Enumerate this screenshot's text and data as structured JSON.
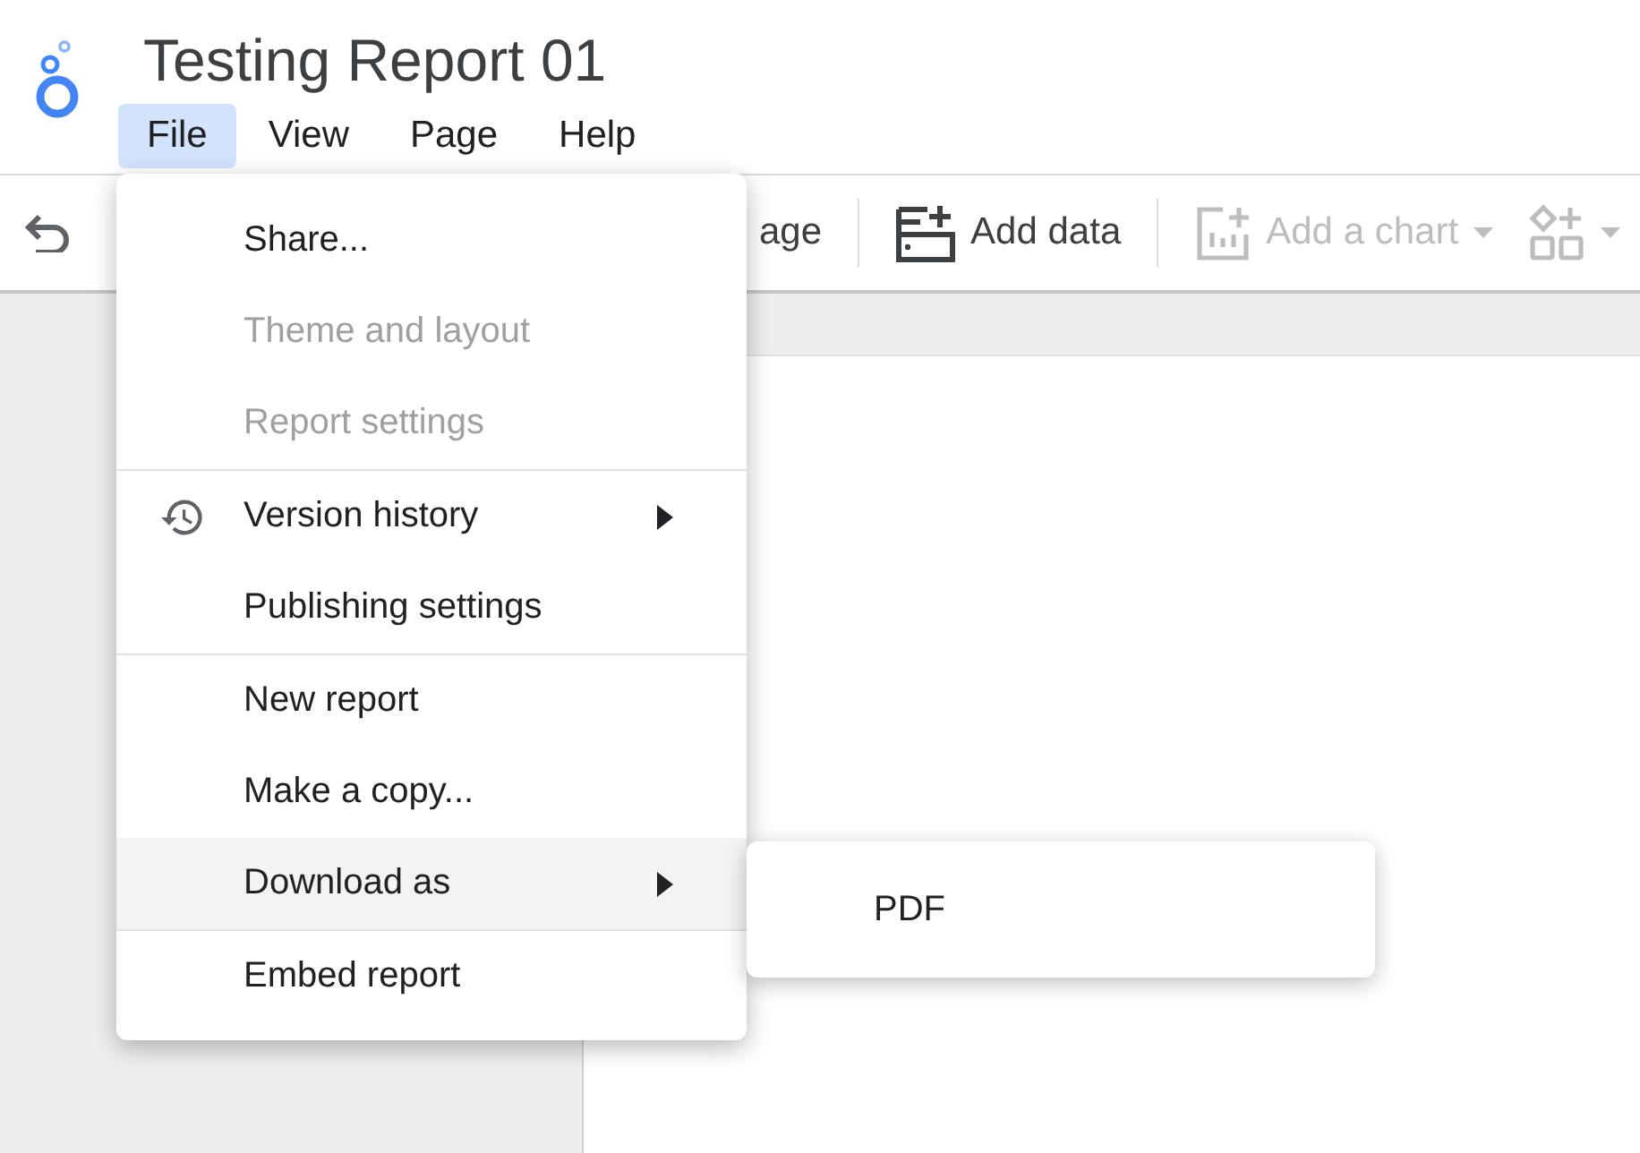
{
  "header": {
    "title": "Testing Report 01"
  },
  "menubar": [
    {
      "label": "File",
      "selected": true
    },
    {
      "label": "View",
      "selected": false
    },
    {
      "label": "Page",
      "selected": false
    },
    {
      "label": "Help",
      "selected": false
    }
  ],
  "toolbar": {
    "partial_label": "age",
    "items": [
      {
        "kind": "add-data",
        "label": "Add data",
        "disabled": false
      },
      {
        "kind": "add-chart",
        "label": "Add a chart",
        "disabled": true
      },
      {
        "kind": "add-control",
        "disabled": true
      }
    ]
  },
  "file_menu": [
    [
      {
        "kind": "plain",
        "label": "Share...",
        "disabled": false,
        "selected": false,
        "submenu": false
      },
      {
        "kind": "plain",
        "label": "Theme and layout",
        "disabled": true,
        "selected": false,
        "submenu": false
      },
      {
        "kind": "plain",
        "label": "Report settings",
        "disabled": true,
        "selected": false,
        "submenu": false
      }
    ],
    [
      {
        "kind": "history",
        "label": "Version history",
        "disabled": false,
        "selected": false,
        "submenu": true
      },
      {
        "kind": "plain",
        "label": "Publishing settings",
        "disabled": false,
        "selected": false,
        "submenu": false
      }
    ],
    [
      {
        "kind": "plain",
        "label": "New report",
        "disabled": false,
        "selected": false,
        "submenu": false
      },
      {
        "kind": "plain",
        "label": "Make a copy...",
        "disabled": false,
        "selected": false,
        "submenu": false
      },
      {
        "kind": "plain",
        "label": "Download as",
        "disabled": false,
        "selected": true,
        "submenu": true
      }
    ],
    [
      {
        "kind": "plain",
        "label": "Embed report",
        "disabled": false,
        "selected": false,
        "submenu": false
      }
    ]
  ],
  "submenu": [
    {
      "label": "PDF"
    }
  ]
}
